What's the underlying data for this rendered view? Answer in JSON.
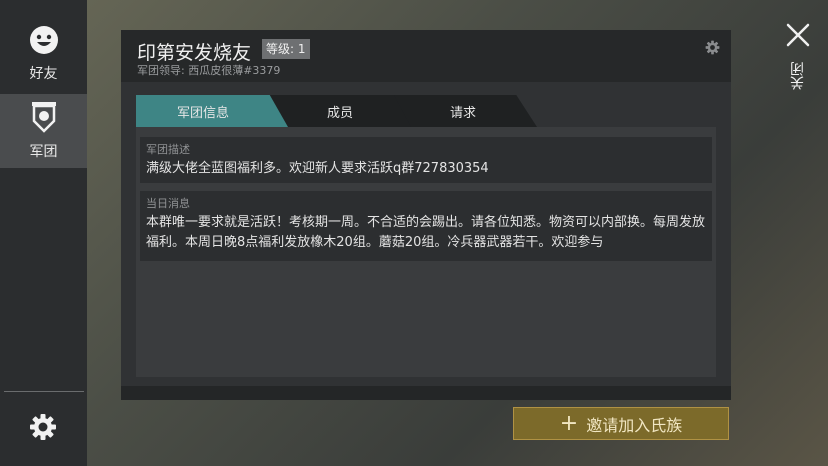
{
  "sidebar": {
    "friends_label": "好友",
    "legion_label": "军团",
    "friends_icon": "smiley-face-icon",
    "legion_icon": "shield-banner-icon",
    "settings_icon": "gear-icon"
  },
  "panel": {
    "title": "印第安发烧友",
    "level": "等级: 1",
    "leader": "军团领导: 西瓜皮很薄#3379",
    "tabs": [
      {
        "label": "军团信息"
      },
      {
        "label": "成员"
      },
      {
        "label": "请求"
      }
    ],
    "description_label": "军团描述",
    "description_text": "满级大佬全蓝图福利多。欢迎新人要求活跃q群727830354",
    "daily_label": "当日消息",
    "daily_text": "本群唯一要求就是活跃！考核期一周。不合适的会踢出。请各位知悉。物资可以内部换。每周发放福利。本周日晚8点福利发放橡木20组。蘑菇20组。冷兵器武器若干。欢迎参与"
  },
  "invite_button": "邀请加入氏族",
  "close_label": "关闭",
  "colors": {
    "active_tab": "#3e8585",
    "invite_button": "#7c6a2a"
  }
}
